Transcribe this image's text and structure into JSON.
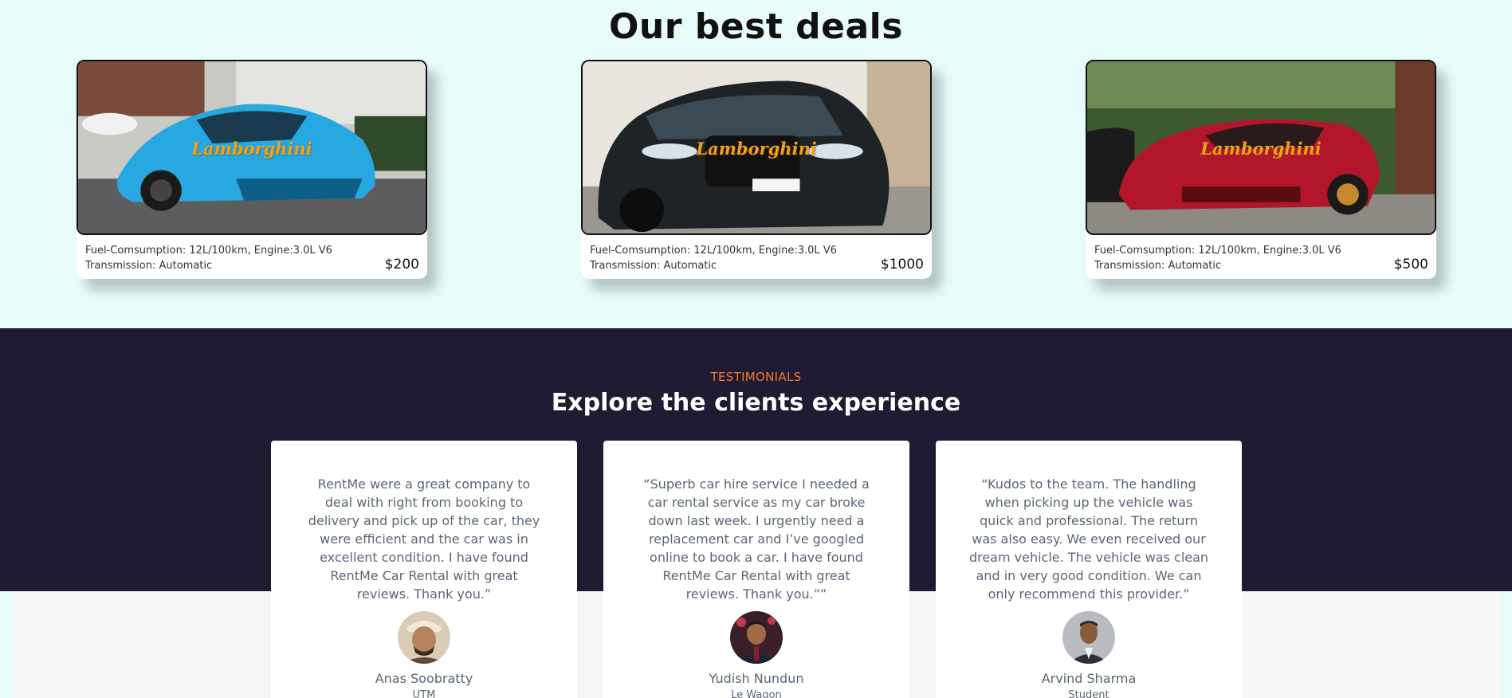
{
  "deals": {
    "title": "Our best deals",
    "cars": [
      {
        "brand": "Lamborghini",
        "specs_line1": "Fuel-Comsumption: 12L/100km, Engine:3.0L V6",
        "specs_line2": "Transmission: Automatic",
        "price": "$200",
        "color": "#27a8e0"
      },
      {
        "brand": "Lamborghini",
        "specs_line1": "Fuel-Comsumption: 12L/100km, Engine:3.0L V6",
        "specs_line2": "Transmission: Automatic",
        "price": "$1000",
        "color": "#1f2326"
      },
      {
        "brand": "Lamborghini",
        "specs_line1": "Fuel-Comsumption: 12L/100km, Engine:3.0L V6",
        "specs_line2": "Transmission: Automatic",
        "price": "$500",
        "color": "#b3162b"
      }
    ]
  },
  "testimonials": {
    "label": "TESTIMONIALS",
    "title": "Explore the clients experience",
    "items": [
      {
        "quote": "RentMe were a great company to deal with right from booking to delivery and pick up of the car, they were efficient and the car was in excellent condition. I have found RentMe Car Rental with great reviews. Thank you.”",
        "name": "Anas Soobratty",
        "org": "UTM"
      },
      {
        "quote": "“Superb car hire service I needed a car rental service as my car broke down last week. I urgently need a replacement car and I’ve googled online to book a car. I have found RentMe Car Rental with great reviews. Thank you.””",
        "name": "Yudish Nundun",
        "org": "Le Wagon"
      },
      {
        "quote": "“Kudos to the team. The handling when picking up the vehicle was quick and professional. The return was also easy. We even received our dream vehicle. The vehicle was clean and in very good condition. We can only recommend this provider.”",
        "name": "Arvind Sharma",
        "org": "Student"
      }
    ]
  },
  "colors": {
    "deals_bg": "#e6fbfa",
    "testimonials_bg": "#211a33",
    "accent": "#f07b2e",
    "brand_text": "#f0a21a"
  }
}
